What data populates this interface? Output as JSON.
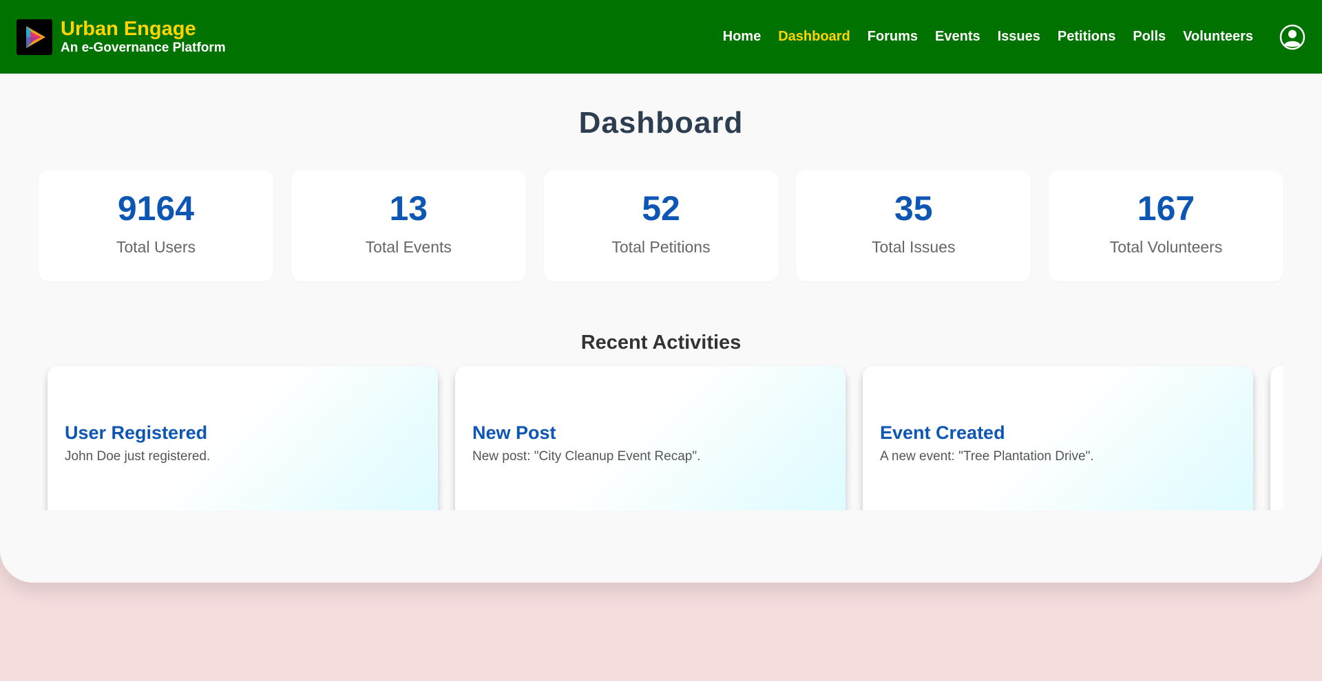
{
  "header": {
    "brand_title": "Urban Engage",
    "brand_subtitle": "An e-Governance Platform",
    "logo_icon": "play-triangle-logo-icon",
    "nav": [
      {
        "label": "Home",
        "active": false
      },
      {
        "label": "Dashboard",
        "active": true
      },
      {
        "label": "Forums",
        "active": false
      },
      {
        "label": "Events",
        "active": false
      },
      {
        "label": "Issues",
        "active": false
      },
      {
        "label": "Petitions",
        "active": false
      },
      {
        "label": "Polls",
        "active": false
      },
      {
        "label": "Volunteers",
        "active": false
      }
    ],
    "profile_icon": "user-avatar-icon"
  },
  "main": {
    "title": "Dashboard",
    "stats": [
      {
        "value": "9164",
        "label": "Total Users"
      },
      {
        "value": "13",
        "label": "Total Events"
      },
      {
        "value": "52",
        "label": "Total Petitions"
      },
      {
        "value": "35",
        "label": "Total Issues"
      },
      {
        "value": "167",
        "label": "Total Volunteers"
      }
    ],
    "recent_title": "Recent Activities",
    "activities": [
      {
        "title": "User Registered",
        "description": "John Doe just registered."
      },
      {
        "title": "New Post",
        "description": "New post: \"City Cleanup Event Recap\"."
      },
      {
        "title": "Event Created",
        "description": "A new event: \"Tree Plantation Drive\"."
      }
    ]
  },
  "colors": {
    "header_bg": "#007200",
    "brand_accent": "#ffd400",
    "stat_value": "#0d56b3",
    "page_bg": "#f5dcdd"
  }
}
